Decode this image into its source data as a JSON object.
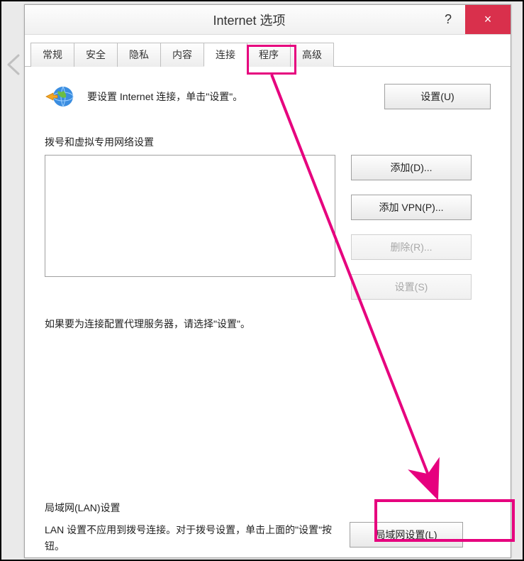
{
  "window": {
    "title": "Internet 选项",
    "help_icon": "?",
    "close_icon": "×"
  },
  "tabs": [
    {
      "label": "常规"
    },
    {
      "label": "安全"
    },
    {
      "label": "隐私"
    },
    {
      "label": "内容"
    },
    {
      "label": "连接",
      "active": true
    },
    {
      "label": "程序"
    },
    {
      "label": "高级"
    }
  ],
  "setup": {
    "text": "要设置 Internet 连接，单击\"设置\"。",
    "button": "设置(U)"
  },
  "dial": {
    "group_label": "拨号和虚拟专用网络设置",
    "buttons": {
      "add": "添加(D)...",
      "add_vpn": "添加 VPN(P)...",
      "remove": "删除(R)...",
      "settings": "设置(S)"
    },
    "note": "如果要为连接配置代理服务器，请选择\"设置\"。"
  },
  "lan": {
    "group_label": "局域网(LAN)设置",
    "text": "LAN 设置不应用到拨号连接。对于拨号设置，单击上面的\"设置\"按钮。",
    "button": "局域网设置(L)"
  },
  "annotation": {
    "arrow_from": "tab-connections",
    "arrow_to": "lan-settings-button"
  }
}
